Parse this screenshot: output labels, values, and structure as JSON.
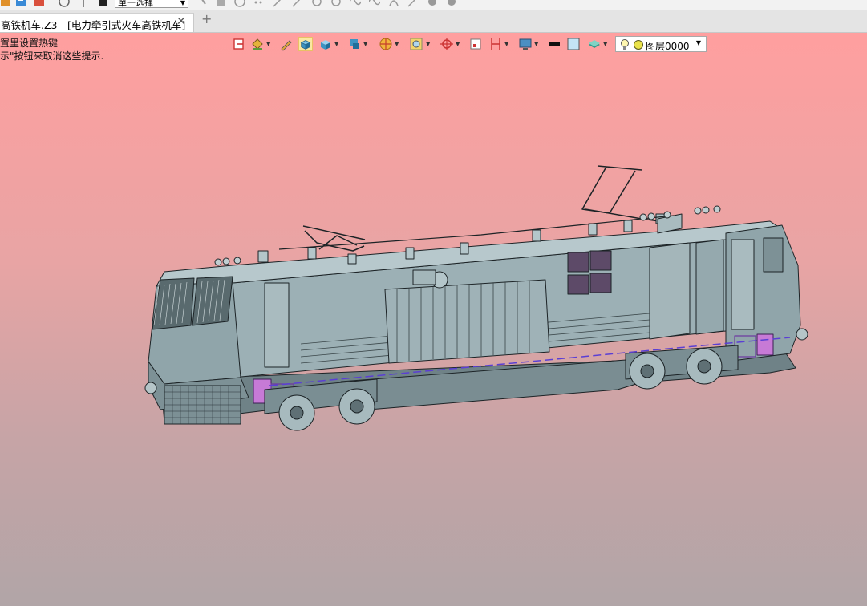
{
  "topbar": {
    "select_value": "單一选择",
    "icons": [
      "app-icon",
      "save-icon",
      "export-icon",
      "history-icon",
      "filter-icon",
      "stop-icon",
      "pointer-icon",
      "line-icon",
      "circle-icon",
      "curve-icon",
      "spline-icon",
      "arc-icon",
      "chamfer-icon",
      "gear-icon"
    ]
  },
  "tabs": [
    {
      "label": "高铁机车.Z3 - [电力牵引式火车高铁机车]"
    }
  ],
  "hints": {
    "line1": "置里设置热键",
    "line2": "示\"按钮来取消这些提示."
  },
  "toolbar": {
    "layer_value": "图层0000",
    "icons": [
      "exit-sketch-icon",
      "paint-bucket-icon",
      "pencil-icon",
      "shaded-view-icon",
      "cube-view-icon",
      "box-display-icon",
      "wheel-icon",
      "zoom-fit-icon",
      "target-icon",
      "frame-icon",
      "dimension-icon",
      "screen-icon",
      "line-color-icon",
      "fill-color-icon",
      "layer-stack-icon",
      "bulb-icon",
      "layer-dot-icon"
    ]
  },
  "colors": {
    "viewport_top": "#ff9f9f",
    "viewport_bottom": "#b1a5a7",
    "model_fill": "#8fa3a8",
    "model_line": "#1c2326",
    "highlight": "#c77ad6",
    "selected_tool": "#fbe7a1"
  }
}
